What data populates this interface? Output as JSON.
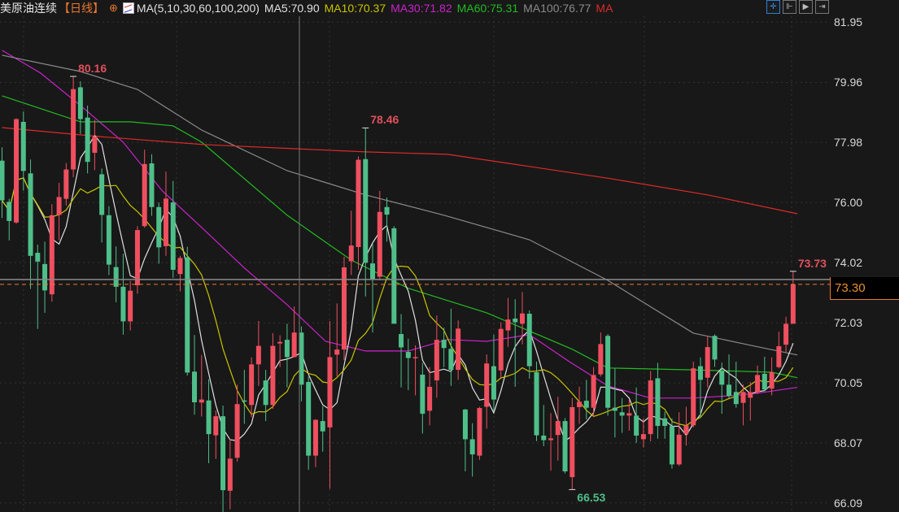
{
  "header": {
    "instrument": "美原油连续",
    "period": "【日线】",
    "add_icon": "circle-plus-icon",
    "ma_label": "MA(5,10,30,60,100,200)",
    "ma5": "MA5:70.90",
    "ma10": "MA10:70.37",
    "ma30": "MA30:71.82",
    "ma60": "MA60:75.31",
    "ma100": "MA100:76.77",
    "ma200": "MA",
    "tools": [
      "crosshair-icon",
      "zoom-in-icon",
      "play-icon",
      "exit-icon"
    ]
  },
  "colors": {
    "background": "#181818",
    "up": "#ef4f5f",
    "down": "#4fbf8a",
    "ma5": "#e0e0e0",
    "ma10": "#c8c400",
    "ma30": "#cc22cc",
    "ma60": "#22bb22",
    "ma100": "#8a8a8a",
    "ma200": "#dd2a2a",
    "current": "#e8772e"
  },
  "chart_data": {
    "type": "candlestick",
    "title": "美原油连续 【日线】",
    "y_ticks": [
      "81.95",
      "79.96",
      "77.98",
      "76.00",
      "74.02",
      "72.03",
      "70.05",
      "68.07",
      "66.09"
    ],
    "ylim": [
      65.79,
      82.68
    ],
    "current_price": "73.30",
    "annotations": [
      {
        "index": 10,
        "value": "80.16",
        "kind": "high"
      },
      {
        "index": 51,
        "value": "78.46",
        "kind": "high"
      },
      {
        "index": 80,
        "value": "66.53",
        "kind": "low"
      },
      {
        "index": 111,
        "value": "73.73",
        "kind": "high"
      }
    ],
    "ohlc": [
      [
        77.38,
        77.82,
        75.49,
        76.07
      ],
      [
        76.02,
        76.12,
        74.75,
        75.39
      ],
      [
        75.34,
        78.78,
        75.3,
        78.75
      ],
      [
        78.66,
        79.0,
        76.39,
        77.04
      ],
      [
        76.96,
        77.42,
        73.15,
        74.24
      ],
      [
        74.34,
        74.61,
        71.83,
        74.05
      ],
      [
        73.97,
        74.71,
        72.36,
        73.1
      ],
      [
        72.97,
        75.95,
        72.73,
        75.58
      ],
      [
        75.59,
        76.65,
        74.76,
        76.18
      ],
      [
        76.12,
        77.3,
        75.9,
        77.09
      ],
      [
        77.09,
        80.16,
        76.83,
        79.74
      ],
      [
        79.8,
        80.0,
        78.26,
        78.75
      ],
      [
        78.8,
        79.2,
        76.96,
        77.34
      ],
      [
        77.64,
        78.73,
        77.07,
        78.17
      ],
      [
        76.93,
        77.12,
        74.68,
        75.59
      ],
      [
        75.58,
        75.88,
        73.61,
        73.95
      ],
      [
        73.87,
        74.55,
        72.71,
        73.22
      ],
      [
        73.22,
        74.31,
        71.64,
        72.08
      ],
      [
        72.08,
        73.41,
        71.78,
        73.09
      ],
      [
        73.27,
        75.22,
        72.99,
        75.09
      ],
      [
        75.22,
        77.74,
        75.17,
        77.27
      ],
      [
        77.29,
        77.59,
        75.56,
        75.85
      ],
      [
        75.85,
        76.0,
        73.98,
        74.52
      ],
      [
        74.56,
        77.02,
        74.24,
        76.13
      ],
      [
        76.0,
        76.71,
        73.51,
        73.78
      ],
      [
        73.64,
        74.24,
        73.07,
        74.17
      ],
      [
        74.19,
        74.54,
        70.29,
        70.39
      ],
      [
        70.42,
        71.63,
        69.0,
        69.41
      ],
      [
        69.4,
        70.97,
        68.94,
        69.5
      ],
      [
        69.47,
        70.17,
        67.4,
        68.36
      ],
      [
        68.32,
        69.14,
        67.54,
        68.95
      ],
      [
        68.95,
        69.3,
        65.79,
        66.51
      ],
      [
        66.49,
        68.2,
        65.88,
        67.55
      ],
      [
        67.58,
        69.99,
        67.45,
        69.35
      ],
      [
        69.47,
        70.48,
        68.7,
        69.44
      ],
      [
        69.32,
        70.89,
        68.92,
        70.66
      ],
      [
        70.66,
        72.09,
        69.95,
        71.27
      ],
      [
        70.13,
        70.48,
        68.79,
        69.32
      ],
      [
        69.32,
        71.69,
        69.19,
        71.27
      ],
      [
        71.35,
        71.62,
        70.57,
        71.4
      ],
      [
        71.47,
        72.0,
        69.9,
        70.9
      ],
      [
        70.9,
        72.57,
        70.89,
        71.71
      ],
      [
        71.71,
        71.91,
        69.44,
        69.99
      ],
      [
        70.08,
        70.26,
        67.18,
        67.65
      ],
      [
        67.65,
        68.85,
        67.27,
        68.83
      ],
      [
        68.79,
        69.28,
        67.78,
        68.45
      ],
      [
        68.58,
        72.09,
        66.55,
        70.9
      ],
      [
        70.98,
        72.67,
        70.26,
        71.15
      ],
      [
        71.15,
        74.21,
        70.8,
        73.86
      ],
      [
        74.06,
        75.73,
        73.61,
        74.58
      ],
      [
        74.53,
        77.52,
        73.79,
        77.41
      ],
      [
        77.43,
        78.46,
        72.9,
        74.01
      ],
      [
        73.99,
        74.64,
        71.71,
        73.48
      ],
      [
        73.55,
        76.38,
        73.43,
        75.69
      ],
      [
        75.85,
        76.16,
        74.71,
        75.6
      ],
      [
        75.15,
        75.22,
        72.0,
        72.0
      ],
      [
        71.66,
        72.32,
        69.9,
        71.22
      ],
      [
        71.07,
        71.51,
        69.81,
        70.87
      ],
      [
        70.86,
        71.29,
        69.64,
        70.9
      ],
      [
        70.32,
        70.71,
        68.38,
        69.03
      ],
      [
        69.13,
        70.57,
        68.65,
        69.92
      ],
      [
        70.13,
        72.27,
        69.56,
        71.47
      ],
      [
        71.47,
        71.87,
        70.57,
        71.2
      ],
      [
        71.17,
        72.5,
        69.95,
        70.48
      ],
      [
        70.48,
        72.11,
        70.15,
        71.84
      ],
      [
        69.17,
        69.19,
        67.13,
        68.19
      ],
      [
        68.19,
        68.72,
        66.96,
        67.69
      ],
      [
        67.65,
        69.26,
        67.51,
        69.22
      ],
      [
        69.26,
        70.99,
        68.54,
        70.69
      ],
      [
        70.6,
        71.64,
        69.1,
        69.5
      ],
      [
        70.46,
        72.05,
        70.22,
        71.83
      ],
      [
        71.78,
        72.85,
        71.24,
        72.14
      ],
      [
        72.17,
        72.81,
        69.92,
        72.05
      ],
      [
        72.0,
        73.05,
        71.32,
        72.34
      ],
      [
        72.33,
        72.44,
        70.19,
        70.6
      ],
      [
        70.4,
        70.75,
        68.13,
        68.32
      ],
      [
        68.31,
        69.32,
        67.96,
        68.16
      ],
      [
        68.16,
        69.05,
        67.15,
        68.22
      ],
      [
        68.33,
        69.59,
        67.49,
        68.79
      ],
      [
        68.79,
        68.89,
        67.06,
        67.13
      ],
      [
        66.94,
        69.55,
        66.53,
        69.25
      ],
      [
        69.25,
        69.92,
        68.7,
        69.43
      ],
      [
        69.46,
        70.15,
        68.85,
        69.23
      ],
      [
        69.23,
        70.57,
        68.92,
        70.31
      ],
      [
        70.33,
        71.71,
        70.26,
        71.33
      ],
      [
        71.6,
        71.66,
        68.97,
        69.23
      ],
      [
        69.23,
        70.53,
        68.25,
        69.13
      ],
      [
        69.08,
        69.55,
        68.4,
        68.97
      ],
      [
        68.97,
        69.5,
        68.47,
        69.05
      ],
      [
        68.97,
        69.9,
        68.07,
        68.31
      ],
      [
        68.19,
        68.88,
        67.92,
        68.36
      ],
      [
        68.36,
        70.44,
        68.12,
        70.13
      ],
      [
        70.2,
        70.71,
        68.21,
        68.63
      ],
      [
        68.88,
        69.1,
        68.21,
        68.63
      ],
      [
        68.62,
        68.88,
        67.22,
        67.36
      ],
      [
        67.36,
        69.08,
        67.31,
        68.34
      ],
      [
        68.37,
        69.26,
        67.98,
        68.65
      ],
      [
        68.65,
        70.75,
        68.58,
        70.53
      ],
      [
        70.6,
        70.89,
        68.92,
        70.15
      ],
      [
        70.22,
        71.6,
        69.9,
        71.23
      ],
      [
        71.6,
        71.65,
        70.58,
        70.82
      ],
      [
        70.44,
        70.72,
        69.03,
        69.99
      ],
      [
        69.99,
        70.99,
        69.55,
        69.62
      ],
      [
        69.75,
        70.75,
        69.23,
        69.35
      ],
      [
        69.39,
        69.99,
        68.65,
        69.75
      ],
      [
        69.56,
        70.08,
        68.81,
        69.74
      ],
      [
        69.74,
        70.62,
        69.68,
        70.31
      ],
      [
        70.35,
        70.91,
        69.77,
        69.83
      ],
      [
        69.86,
        70.89,
        69.64,
        70.4
      ],
      [
        70.57,
        71.74,
        70.53,
        71.26
      ],
      [
        71.31,
        72.23,
        71.07,
        72.0
      ],
      [
        72.0,
        73.73,
        72.0,
        73.3
      ]
    ],
    "ma_computed": [
      {
        "name": "MA5",
        "period": 5,
        "color_key": "ma5"
      },
      {
        "name": "MA10",
        "period": 10,
        "color_key": "ma10"
      }
    ],
    "ma_sampled": [
      {
        "name": "MA30",
        "color_key": "ma30",
        "points": [
          [
            0,
            81.02
          ],
          [
            5.4,
            80.27
          ],
          [
            11,
            79.2
          ],
          [
            17,
            77.99
          ],
          [
            22.5,
            76.38
          ],
          [
            28,
            75.18
          ],
          [
            34,
            73.84
          ],
          [
            40,
            72.63
          ],
          [
            45.4,
            71.42
          ],
          [
            51,
            71.1
          ],
          [
            57,
            71.1
          ],
          [
            62.5,
            71.48
          ],
          [
            68,
            71.42
          ],
          [
            74,
            71.64
          ],
          [
            79.6,
            70.75
          ],
          [
            85,
            69.95
          ],
          [
            91,
            69.55
          ],
          [
            97,
            69.55
          ],
          [
            102.5,
            69.63
          ],
          [
            106,
            69.71
          ],
          [
            111.6,
            69.9
          ]
        ]
      },
      {
        "name": "MA60",
        "color_key": "ma60",
        "points": [
          [
            0,
            79.52
          ],
          [
            11,
            78.66
          ],
          [
            18,
            78.66
          ],
          [
            24,
            78.53
          ],
          [
            28,
            77.99
          ],
          [
            40,
            75.58
          ],
          [
            49,
            74.1
          ],
          [
            57,
            73.17
          ],
          [
            68,
            72.36
          ],
          [
            80,
            71.16
          ],
          [
            85,
            70.54
          ],
          [
            97,
            70.48
          ],
          [
            108,
            70.4
          ],
          [
            111.6,
            70.22
          ]
        ]
      },
      {
        "name": "MA100",
        "color_key": "ma100",
        "points": [
          [
            0,
            80.86
          ],
          [
            11,
            80.32
          ],
          [
            19,
            79.73
          ],
          [
            28,
            78.39
          ],
          [
            40,
            77.05
          ],
          [
            51,
            76.25
          ],
          [
            62,
            75.58
          ],
          [
            74,
            74.77
          ],
          [
            85,
            73.43
          ],
          [
            97,
            71.69
          ],
          [
            105,
            71.29
          ],
          [
            111.6,
            70.97
          ]
        ]
      },
      {
        "name": "MA200",
        "color_key": "ma200",
        "points": [
          [
            0,
            78.47
          ],
          [
            13.4,
            78.18
          ],
          [
            28.3,
            77.91
          ],
          [
            51,
            77.67
          ],
          [
            62.5,
            77.59
          ],
          [
            74,
            77.19
          ],
          [
            85.3,
            76.79
          ],
          [
            99,
            76.25
          ],
          [
            111.6,
            75.63
          ]
        ]
      }
    ]
  }
}
